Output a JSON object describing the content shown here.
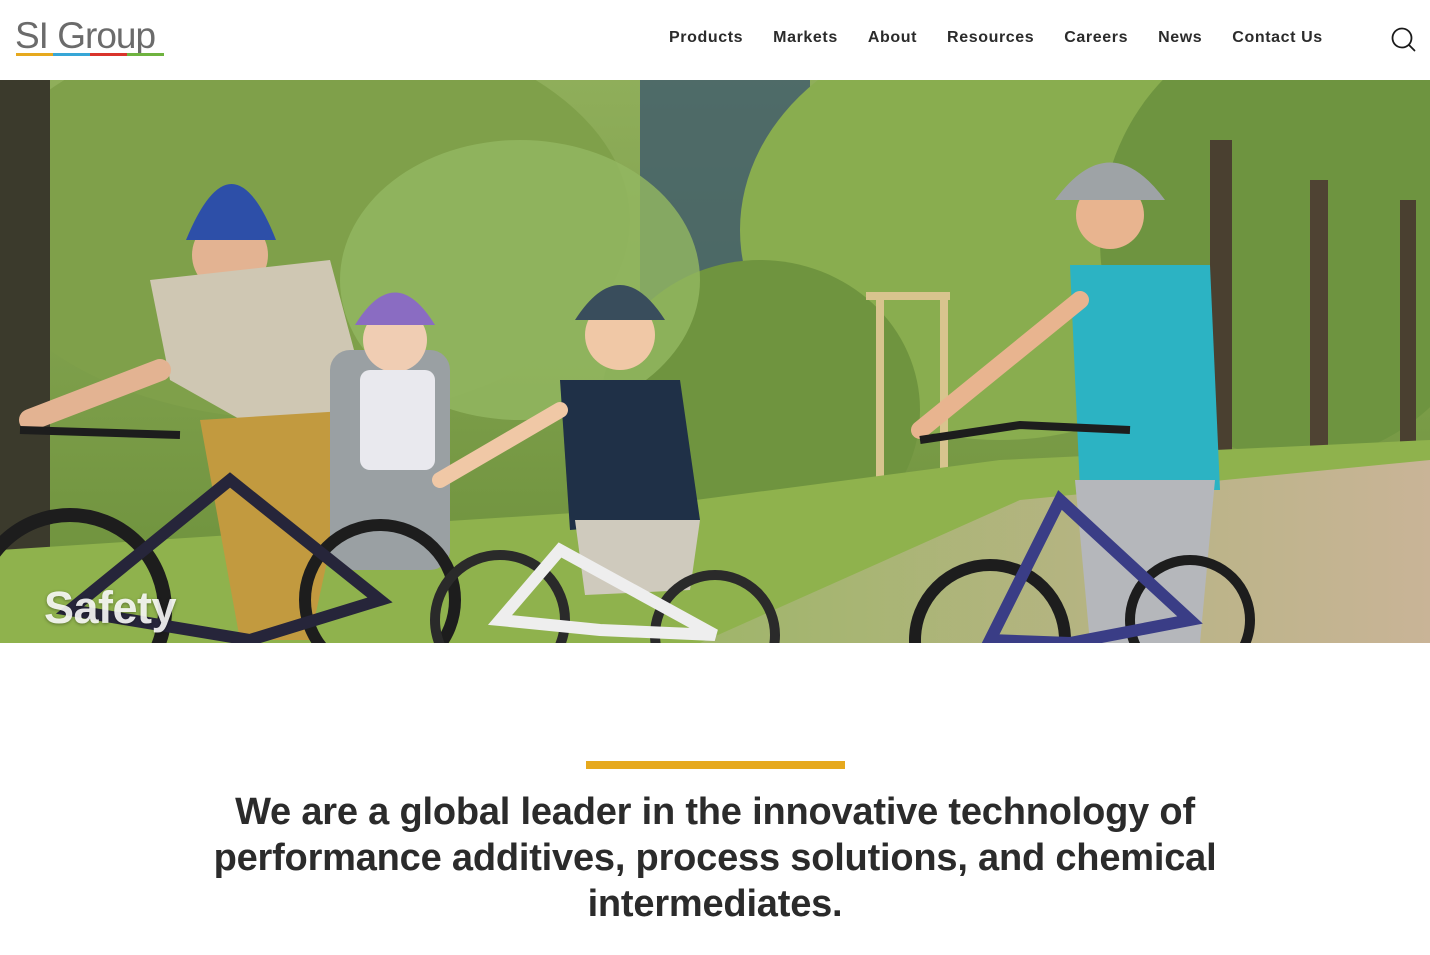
{
  "brand": {
    "logo_text": "SI Group",
    "logo_colors": [
      "#e6a91e",
      "#37a6d6",
      "#d9342b",
      "#6fb33f"
    ]
  },
  "nav": {
    "items": [
      "Products",
      "Markets",
      "About",
      "Resources",
      "Careers",
      "News",
      "Contact Us"
    ],
    "search_icon": "search-icon"
  },
  "hero": {
    "caption": "Safety"
  },
  "intro": {
    "accent_color": "#e6a91e",
    "tagline": "We are a global leader in the innovative technology of performance additives, process solutions, and chemical intermediates."
  }
}
